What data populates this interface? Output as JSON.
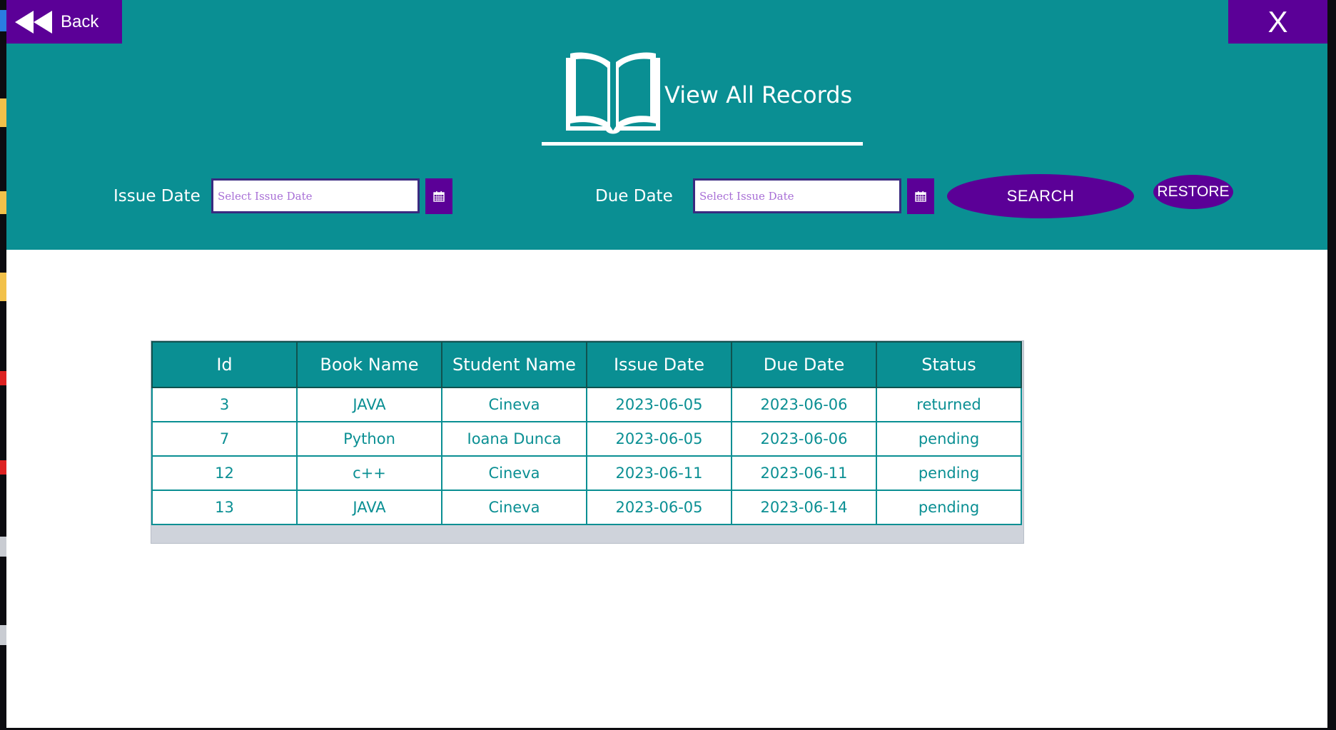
{
  "window": {
    "back_label": "Back",
    "close_label": "X"
  },
  "header": {
    "title": "View All Records",
    "issue_date_label": "Issue Date",
    "issue_date_placeholder": "Select Issue Date",
    "issue_date_value": "",
    "due_date_label": "Due Date",
    "due_date_placeholder": "Select Issue Date",
    "due_date_value": "",
    "search_label": "SEARCH",
    "restore_label": "RESTORE"
  },
  "table": {
    "columns": [
      "Id",
      "Book Name",
      "Student Name",
      "Issue Date",
      "Due Date",
      "Status"
    ],
    "rows": [
      [
        "3",
        "JAVA",
        "Cineva",
        "2023-06-05",
        "2023-06-06",
        "returned"
      ],
      [
        "7",
        "Python",
        "Ioana Dunca",
        "2023-06-05",
        "2023-06-06",
        "pending"
      ],
      [
        "12",
        "c++",
        "Cineva",
        "2023-06-11",
        "2023-06-11",
        "pending"
      ],
      [
        "13",
        "JAVA",
        "Cineva",
        "2023-06-05",
        "2023-06-14",
        "pending"
      ]
    ]
  },
  "colors": {
    "header_teal": "#0a8f93",
    "button_purple": "#5b0097",
    "cell_text": "#0a8f93"
  },
  "icons": [
    "rewind-icon",
    "book-open-icon",
    "calendar-icon"
  ]
}
